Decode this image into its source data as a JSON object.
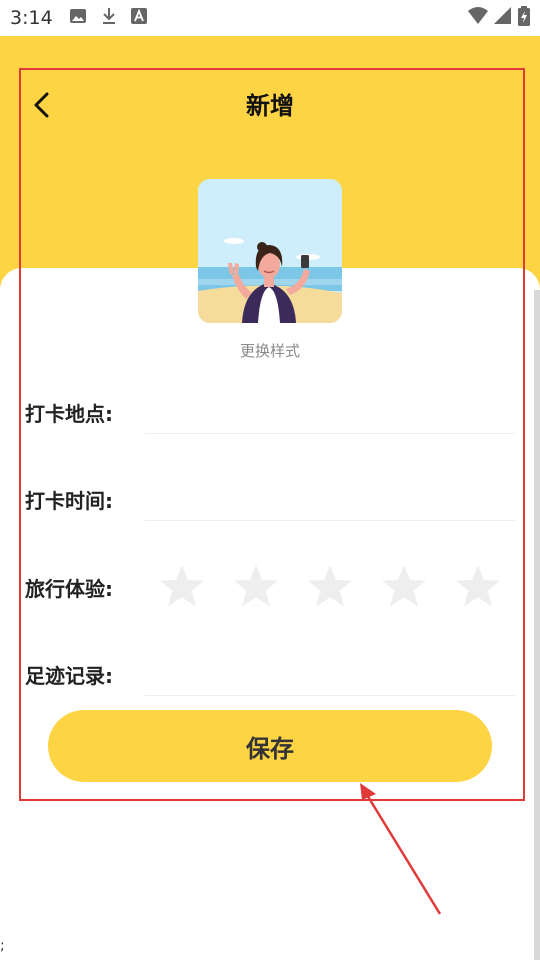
{
  "status_bar": {
    "time": "3:14",
    "icons": [
      "image-icon",
      "download-icon",
      "font-icon"
    ],
    "right_icons": [
      "wifi-icon",
      "signal-icon",
      "battery-charging-icon"
    ]
  },
  "header": {
    "title": "新增",
    "back_icon": "chevron-left-icon"
  },
  "cover": {
    "change_style_label": "更换样式"
  },
  "form": {
    "location_label": "打卡地点:",
    "location_value": "",
    "time_label": "打卡时间:",
    "time_value": "",
    "experience_label": "旅行体验:",
    "rating": 0,
    "rating_max": 5,
    "footprint_label": "足迹记录:",
    "footprint_value": ""
  },
  "save_button": "保存",
  "stray_text": ";",
  "colors": {
    "accent": "#fdd444",
    "star_inactive": "#eeeeee",
    "annotation": "#e03a3a"
  }
}
